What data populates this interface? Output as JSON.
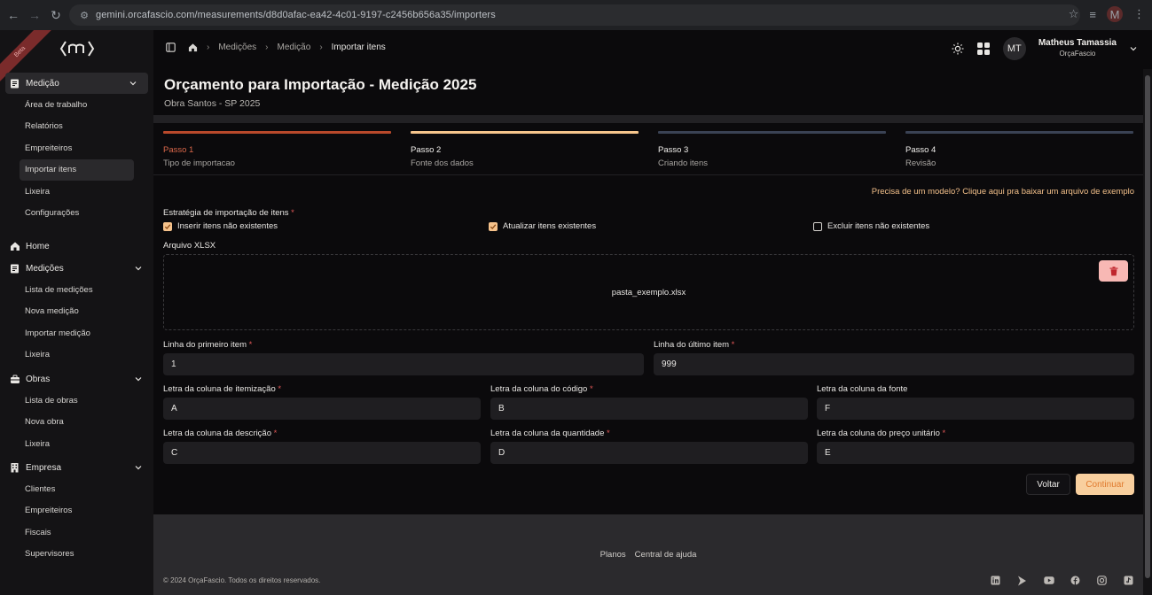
{
  "browser": {
    "url": "gemini.orcafascio.com/measurements/d8d0afac-ea42-4c01-9197-c2456b656a35/importers",
    "profile_initial": "M"
  },
  "sidebar": {
    "ribbon": "Beta",
    "groups": [
      {
        "label": "Medição",
        "items": [
          "Área de trabalho",
          "Relatórios",
          "Empreiteiros",
          "Importar itens",
          "Lixeira",
          "Configurações"
        ]
      },
      {
        "label": "Home"
      },
      {
        "label": "Medições",
        "items": [
          "Lista de medições",
          "Nova medição",
          "Importar medição",
          "Lixeira"
        ]
      },
      {
        "label": "Obras",
        "items": [
          "Lista de obras",
          "Nova obra",
          "Lixeira"
        ]
      },
      {
        "label": "Empresa",
        "items": [
          "Clientes",
          "Empreiteiros",
          "Fiscais",
          "Supervisores"
        ]
      }
    ]
  },
  "topbar": {
    "breadcrumb": [
      "Medições",
      "Medição",
      "Importar itens"
    ],
    "user_initials": "MT",
    "user_name": "Matheus Tamassia",
    "user_org": "OrçaFascio"
  },
  "page": {
    "title": "Orçamento para Importação - Medição 2025",
    "subtitle": "Obra Santos - SP 2025"
  },
  "steps": [
    {
      "num": "Passo 1",
      "desc": "Tipo de importacao",
      "color": "#b9492b"
    },
    {
      "num": "Passo 2",
      "desc": "Fonte dos dados",
      "color": "#f6c58c"
    },
    {
      "num": "Passo 3",
      "desc": "Criando itens",
      "color": "#3a4254"
    },
    {
      "num": "Passo 4",
      "desc": "Revisão",
      "color": "#3a4254"
    }
  ],
  "form": {
    "model_link": "Precisa de um modelo? Clique aqui pra baixar um arquivo de exemplo",
    "strategy_label": "Estratégia de importação de itens",
    "checks": [
      {
        "label": "Inserir itens não existentes",
        "checked": true
      },
      {
        "label": "Atualizar itens existentes",
        "checked": true
      },
      {
        "label": "Excluir itens não existentes",
        "checked": false
      }
    ],
    "file_label": "Arquivo XLSX",
    "file_name": "pasta_exemplo.xlsx",
    "first_row_label": "Linha do primeiro item",
    "first_row_value": "1",
    "last_row_label": "Linha do último item",
    "last_row_value": "999",
    "col_item_label": "Letra da coluna de itemização",
    "col_item_value": "A",
    "col_code_label": "Letra da coluna do código",
    "col_code_value": "B",
    "col_source_label": "Letra da coluna da fonte",
    "col_source_value": "F",
    "col_desc_label": "Letra da coluna da descrição",
    "col_desc_value": "C",
    "col_qty_label": "Letra da coluna da quantidade",
    "col_qty_value": "D",
    "col_price_label": "Letra da coluna do preço unitário",
    "col_price_value": "E",
    "back_label": "Voltar",
    "continue_label": "Continuar"
  },
  "footer": {
    "links": [
      "Planos",
      "Central de ajuda"
    ],
    "copyright": "© 2024 OrçaFascio. Todos os direitos reservados."
  }
}
